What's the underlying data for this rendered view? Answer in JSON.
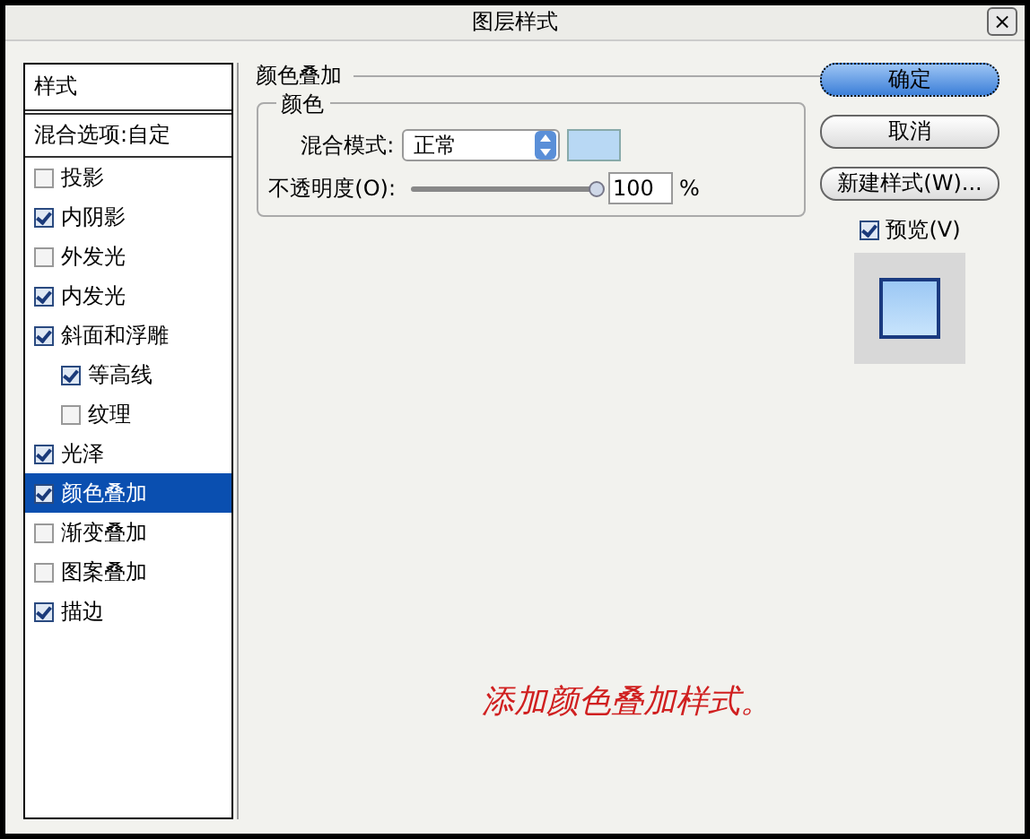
{
  "window": {
    "title": "图层样式",
    "close_label": "×"
  },
  "styles_list": [
    {
      "label": "样式",
      "kind": "header",
      "selected": false
    },
    {
      "label": "混合选项:自定",
      "kind": "plain",
      "selected": false
    },
    {
      "label": "投影",
      "kind": "check",
      "checked": false,
      "selected": false
    },
    {
      "label": "内阴影",
      "kind": "check",
      "checked": true,
      "selected": false
    },
    {
      "label": "外发光",
      "kind": "check",
      "checked": false,
      "selected": false
    },
    {
      "label": "内发光",
      "kind": "check",
      "checked": true,
      "selected": false
    },
    {
      "label": "斜面和浮雕",
      "kind": "check",
      "checked": true,
      "selected": false,
      "children": [
        {
          "label": "等高线",
          "kind": "check",
          "checked": true,
          "selected": false
        },
        {
          "label": "纹理",
          "kind": "check",
          "checked": false,
          "selected": false
        }
      ]
    },
    {
      "label": "光泽",
      "kind": "check",
      "checked": true,
      "selected": false
    },
    {
      "label": "颜色叠加",
      "kind": "check",
      "checked": true,
      "selected": true
    },
    {
      "label": "渐变叠加",
      "kind": "check",
      "checked": false,
      "selected": false
    },
    {
      "label": "图案叠加",
      "kind": "check",
      "checked": false,
      "selected": false
    },
    {
      "label": "描边",
      "kind": "check",
      "checked": true,
      "selected": false
    }
  ],
  "color_overlay": {
    "title": "颜色叠加",
    "group_title": "颜色",
    "blend_label": "混合模式:",
    "blend_value": "正常",
    "color": "#b8d8f4",
    "opacity_label": "不透明度(O):",
    "opacity": {
      "level": 1.0
    },
    "opacity_value": "100",
    "percent": "%"
  },
  "buttons": [
    {
      "label": "确定",
      "default": true
    },
    {
      "label": "取消",
      "default": false
    },
    {
      "label": "新建样式(W)...",
      "default": false
    }
  ],
  "preview": {
    "label": "预览(V)",
    "checked": true
  },
  "annotation": "添加颜色叠加样式。"
}
